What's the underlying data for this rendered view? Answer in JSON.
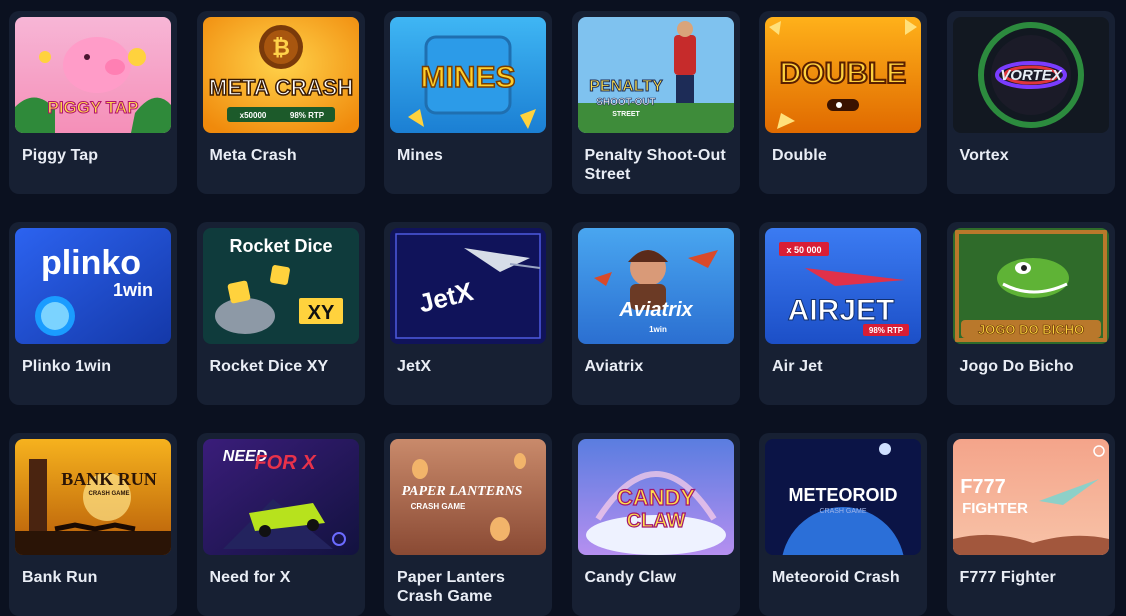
{
  "games": [
    {
      "name": "Piggy Tap",
      "art": "PIGGY TAP"
    },
    {
      "name": "Meta Crash",
      "art": "META CRASH",
      "art2": "x50000",
      "art3": "98% RTP"
    },
    {
      "name": "Mines",
      "art": "MINES"
    },
    {
      "name": "Penalty Shoot-Out Street",
      "art": "PENALTY",
      "art2": "SHOOT-OUT",
      "art3": "STREET"
    },
    {
      "name": "Double",
      "art": "DOUBLE"
    },
    {
      "name": "Vortex",
      "art": "VORTEX"
    },
    {
      "name": "Plinko 1win",
      "art": "plinko",
      "art2": "1win"
    },
    {
      "name": "Rocket Dice XY",
      "art": "Rocket Dice",
      "art2": "XY"
    },
    {
      "name": "JetX",
      "art": "JetX"
    },
    {
      "name": "Aviatrix",
      "art": "Aviatrix",
      "art2": "1win"
    },
    {
      "name": "Air Jet",
      "art": "AIRJET",
      "art2": "x 50 000",
      "art3": "98% RTP"
    },
    {
      "name": "Jogo Do Bicho",
      "art": "JOGO DO BICHO"
    },
    {
      "name": "Bank Run",
      "art": "BANK RUN",
      "art2": "CRASH GAME"
    },
    {
      "name": "Need for X",
      "art": "NEED",
      "art2": "FOR X"
    },
    {
      "name": "Paper Lanters Crash Game",
      "art": "PAPER LANTERNS",
      "art2": "CRASH GAME"
    },
    {
      "name": "Candy Claw",
      "art": "CANDY",
      "art2": "CLAW"
    },
    {
      "name": "Meteoroid Crash",
      "art": "METEOROID",
      "art2": "CRASH GAME"
    },
    {
      "name": "F777 Fighter",
      "art": "F777",
      "art2": "FIGHTER"
    }
  ]
}
